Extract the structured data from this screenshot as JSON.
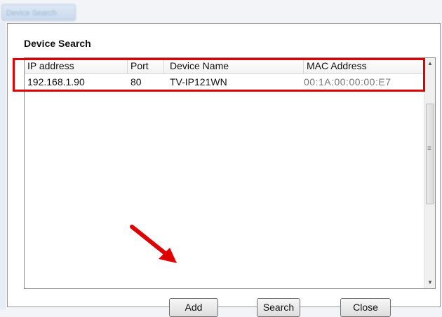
{
  "background": {
    "tab_label": "Device Search"
  },
  "dialog": {
    "title": "Device Search"
  },
  "table": {
    "columns": [
      "IP address",
      "Port",
      "Device Name",
      "MAC Address"
    ],
    "rows": [
      {
        "ip": "192.168.1.90",
        "port": "80",
        "device_name": "TV-IP121WN",
        "mac": "00:1A:00:00:00:E7"
      }
    ]
  },
  "scrollbar": {
    "menu_glyph": "≡"
  },
  "buttons": {
    "add": "Add",
    "search": "Search",
    "close": "Close"
  },
  "colors": {
    "highlight": "#e00000",
    "annotation_arrow": "#e00000"
  }
}
